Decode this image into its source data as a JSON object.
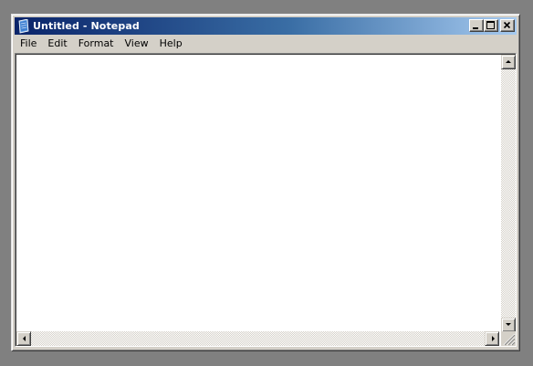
{
  "window": {
    "title": "Untitled - Notepad",
    "icon": "notepad-icon"
  },
  "title_buttons": {
    "minimize": "minimize-icon",
    "maximize": "maximize-icon",
    "close": "close-icon"
  },
  "menu": {
    "items": [
      {
        "label": "File"
      },
      {
        "label": "Edit"
      },
      {
        "label": "Format"
      },
      {
        "label": "View"
      },
      {
        "label": "Help"
      }
    ]
  },
  "editor": {
    "value": ""
  },
  "scrollbars": {
    "up": "scroll-up-arrow-icon",
    "down": "scroll-down-arrow-icon",
    "left": "scroll-left-arrow-icon",
    "right": "scroll-right-arrow-icon"
  },
  "colors": {
    "titlebar_start": "#0a246a",
    "titlebar_end": "#a6caf0",
    "chrome": "#d4d0c8",
    "desktop": "#808080"
  }
}
